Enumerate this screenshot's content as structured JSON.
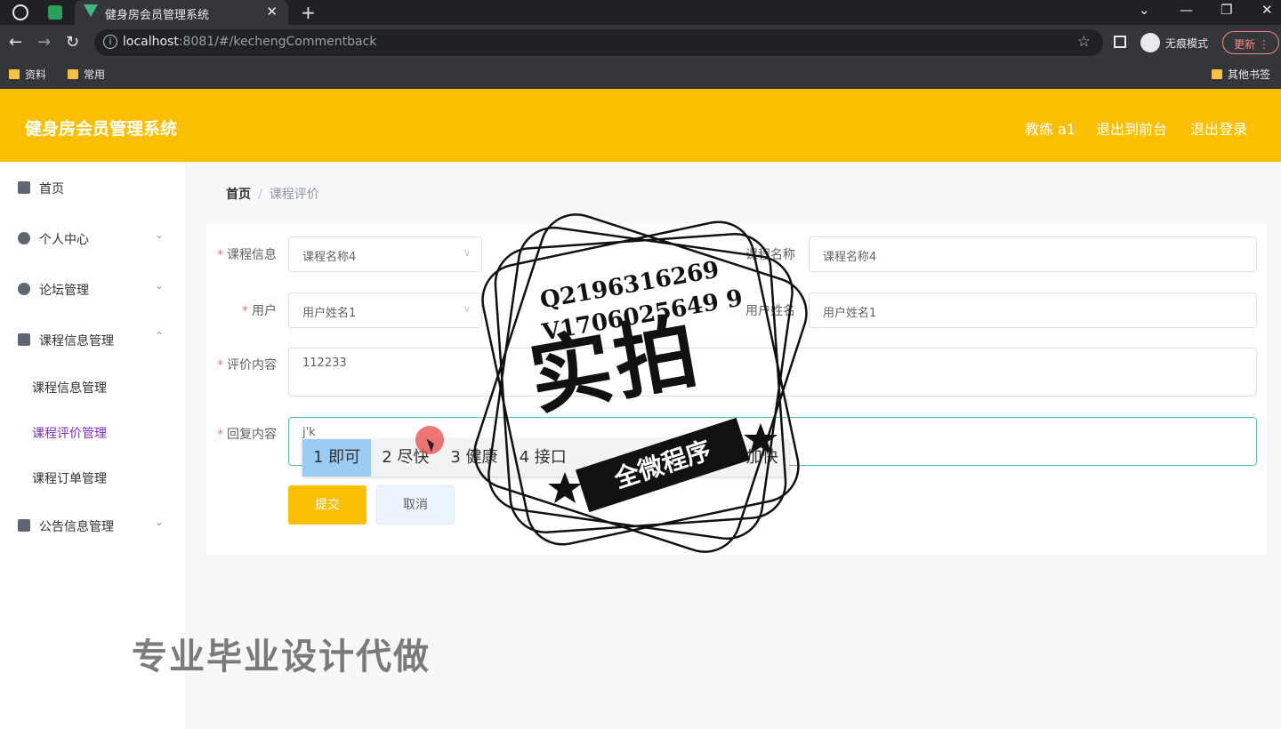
{
  "browser": {
    "tab_title": "健身房会员管理系统",
    "url_host": "localhost",
    "url_path": ":8081/#/kechengCommentback",
    "incognito_label": "无痕模式",
    "update_label": "更新",
    "bookmarks": [
      "资料",
      "常用"
    ],
    "other_bookmarks": "其他书签"
  },
  "header": {
    "title": "健身房会员管理系统",
    "user": "教练 a1",
    "to_front": "退出到前台",
    "logout": "退出登录"
  },
  "sidebar": {
    "items": [
      {
        "label": "首页",
        "icon": "home-icon"
      },
      {
        "label": "个人中心",
        "icon": "user-icon"
      },
      {
        "label": "论坛管理",
        "icon": "bulb-icon"
      },
      {
        "label": "课程信息管理",
        "icon": "chat-icon"
      },
      {
        "label": "公告信息管理",
        "icon": "monitor-icon"
      }
    ],
    "sub_items": [
      "课程信息管理",
      "课程评价管理",
      "课程订单管理"
    ]
  },
  "breadcrumb": {
    "home": "首页",
    "current": "课程评价"
  },
  "form": {
    "course_info_label": "课程信息",
    "course_info_value": "课程名称4",
    "course_name_label": "课程名称",
    "course_name_value": "课程名称4",
    "user_label": "用户",
    "user_value": "用户姓名1",
    "user_name_label": "用户姓名",
    "user_name_value": "用户姓名1",
    "comment_label": "评价内容",
    "comment_value": "112233",
    "reply_label": "回复内容",
    "reply_value": "j'k",
    "submit": "提交",
    "cancel": "取消"
  },
  "ime": {
    "candidates": [
      "1 即可",
      "2 尽快",
      "3 健康",
      "4 接口",
      "加快"
    ]
  },
  "overlay": {
    "contact_q": "Q2196316269",
    "contact_v": "V1706025649 9",
    "stamp_big": "实拍",
    "stamp_ribbon": "全微程序",
    "promo": "专业毕业设计代做"
  }
}
